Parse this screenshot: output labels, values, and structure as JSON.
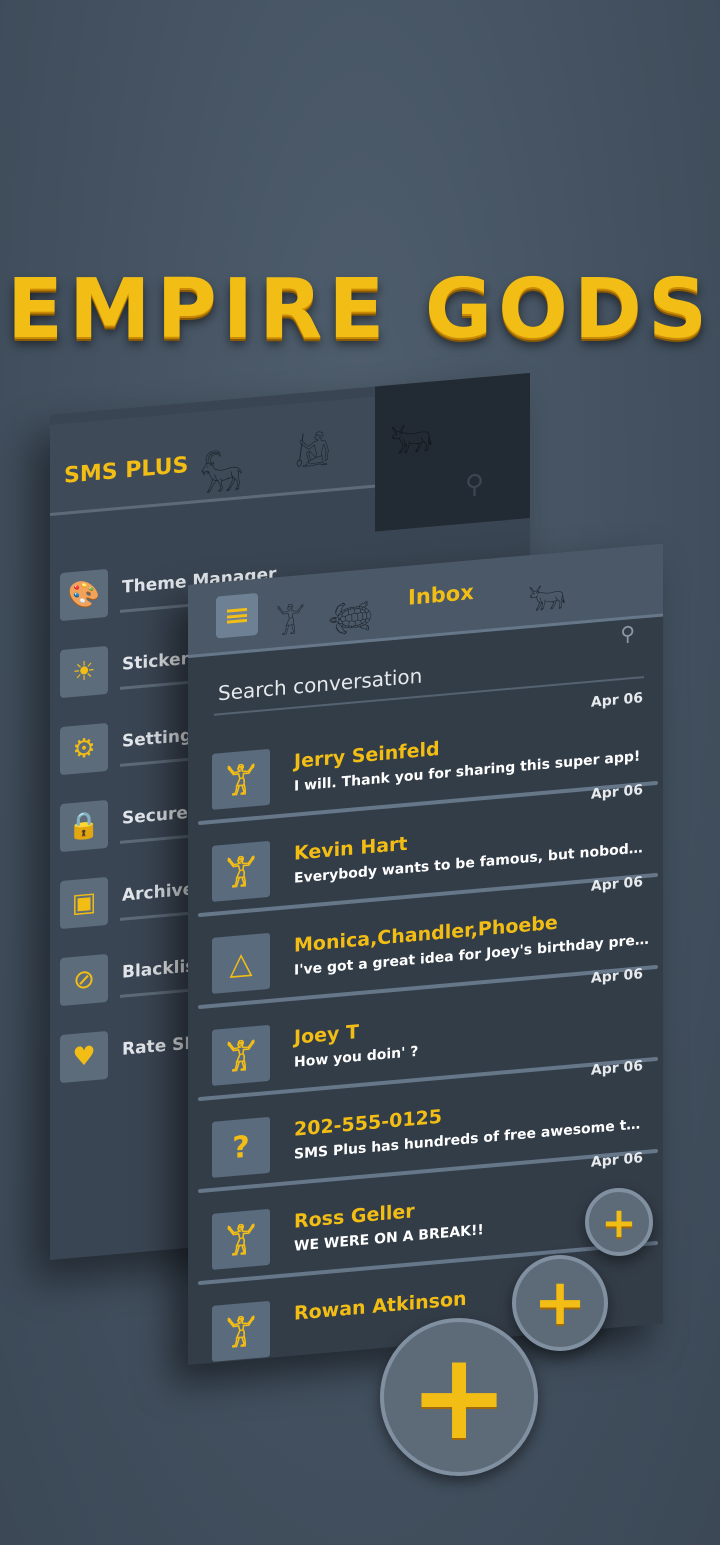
{
  "hero": {
    "title": "EMPIRE GODS"
  },
  "drawer": {
    "app_title": "SMS PLUS",
    "items": [
      {
        "label": "Theme Manager",
        "icon": "palette-icon"
      },
      {
        "label": "Stickers",
        "icon": "smiley-sun-icon"
      },
      {
        "label": "Settings",
        "icon": "gear-icon"
      },
      {
        "label": "Secure Box",
        "icon": "lock-icon"
      },
      {
        "label": "Archive",
        "icon": "archive-box-icon"
      },
      {
        "label": "Blacklist",
        "icon": "blocked-user-icon"
      },
      {
        "label": "Rate SMS Plus",
        "icon": "heart-icon"
      }
    ]
  },
  "inbox": {
    "title": "Inbox",
    "search": {
      "placeholder": "Search conversation"
    },
    "conversations": [
      {
        "name": "Jerry Seinfeld",
        "message": "I will. Thank you for sharing this super app!",
        "date": "Apr 06",
        "avatar": "dancer-figure-icon"
      },
      {
        "name": "Kevin Hart",
        "message": "Everybody wants to be famous, but nobody wants to w…",
        "date": "Apr 06",
        "avatar": "dancer-figure-icon"
      },
      {
        "name": "Monica,Chandler,Phoebe",
        "message": "I've got a great idea for Joey's birthday present featur…",
        "date": "Apr 06",
        "avatar": "tent-icon"
      },
      {
        "name": "Joey T",
        "message": "How you doin' ?",
        "date": "Apr 06",
        "avatar": "dancer-figure-icon"
      },
      {
        "name": "202-555-0125",
        "message": "SMS Plus has hundreds of free awesome themes adde…",
        "date": "Apr 06",
        "avatar": "question-mark-icon"
      },
      {
        "name": "Ross Geller",
        "message": "WE WERE ON  A BREAK!!",
        "date": "Apr 06",
        "avatar": "dancer-figure-icon"
      },
      {
        "name": "Rowan Atkinson",
        "message": "",
        "date": "",
        "avatar": "dancer-figure-icon"
      }
    ]
  },
  "colors": {
    "accent": "#f2bd14",
    "panel": "#333d48",
    "header": "#4a5867",
    "background": "#435160"
  }
}
